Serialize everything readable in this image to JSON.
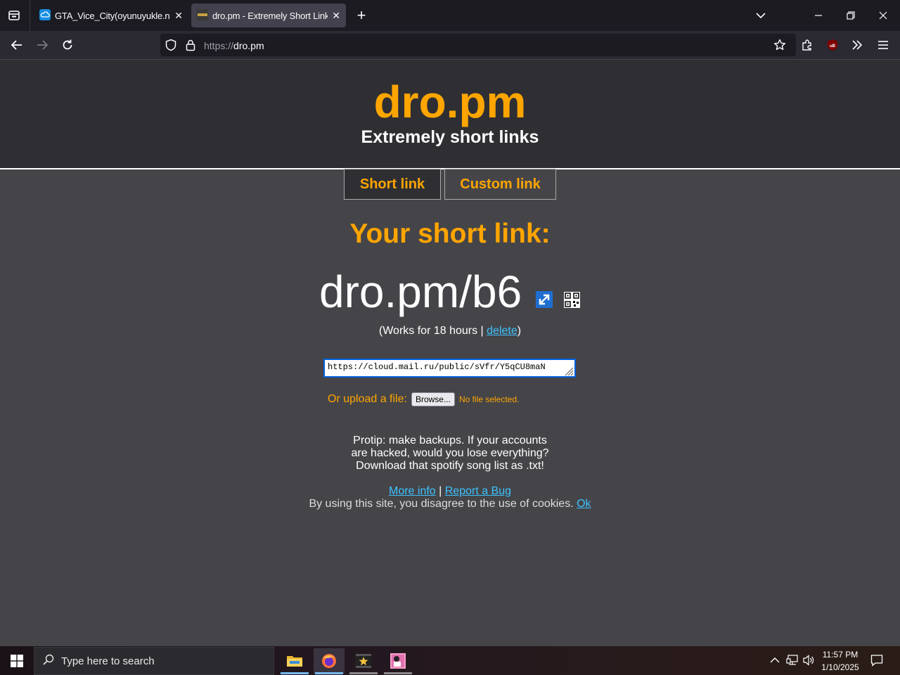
{
  "browser": {
    "tabs": [
      {
        "title": "GTA_Vice_City(oyunuyukle.net)",
        "active": false
      },
      {
        "title": "dro.pm - Extremely Short Links",
        "active": true
      }
    ],
    "url_protocol": "https://",
    "url_host": "dro.pm"
  },
  "page": {
    "site_title": "dro.pm",
    "site_subtitle": "Extremely short links",
    "tab_short": "Short link",
    "tab_custom": "Custom link",
    "your_short_link": "Your short link:",
    "short_link": "dro.pm/b6",
    "works_prefix": "(Works for 18 hours | ",
    "delete_label": "delete",
    "works_suffix": ")",
    "url_value": "https://cloud.mail.ru/public/sVfr/Y5qCU8maN",
    "upload_label": "Or upload a file:",
    "browse_label": "Browse...",
    "no_file": "No file selected.",
    "protip_1": "Protip: make backups. If your accounts",
    "protip_2": "are hacked, would you lose everything?",
    "protip_3": "Download that spotify song list as .txt!",
    "more_info": "More info",
    "separator": " | ",
    "report_bug": "Report a Bug",
    "cookies_text": "By using this site, you disagree to the use of cookies. ",
    "ok_label": "Ok"
  },
  "taskbar": {
    "search_placeholder": "Type here to search",
    "time": "11:57 PM",
    "date": "1/10/2025"
  },
  "colors": {
    "accent": "#ffa500",
    "link": "#3ec3ff",
    "page_bg": "#454549",
    "header_bg": "#2f2f33"
  }
}
